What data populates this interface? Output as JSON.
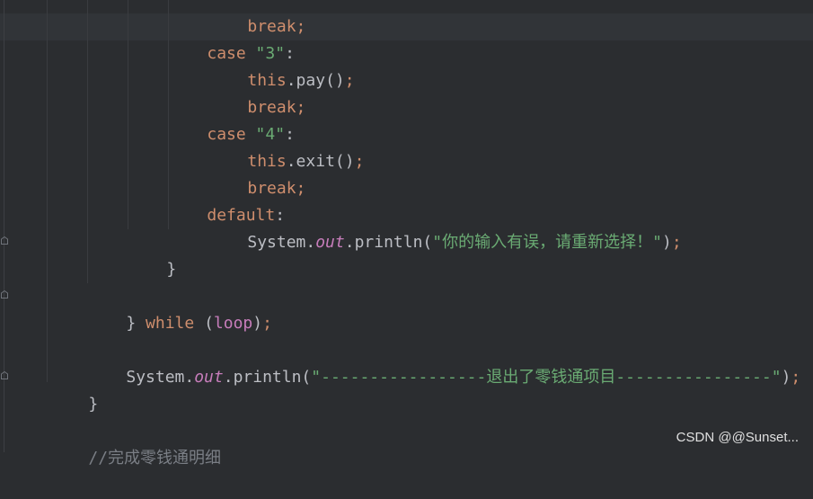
{
  "code": {
    "l0": {
      "kw": "break;"
    },
    "l1": {
      "kw": "case ",
      "str": "\"3\"",
      "tail": ":"
    },
    "l2": {
      "this": "this",
      "call": ".pay()",
      "semi": ";"
    },
    "l3": {
      "kw": "break;"
    },
    "l4": {
      "kw": "case ",
      "str": "\"4\"",
      "tail": ":"
    },
    "l5": {
      "this": "this",
      "call": ".exit()",
      "semi": ";"
    },
    "l6": {
      "kw": "break;"
    },
    "l7": {
      "kw": "default",
      "tail": ":"
    },
    "l8": {
      "pre": "System.",
      "field": "out",
      "mid": ".println(",
      "str": "\"你的输入有误，请重新选择！\"",
      "post": ")",
      "semi": ";"
    },
    "l9": {
      "brace": "}"
    },
    "l11": {
      "brace": "} ",
      "kw": "while",
      "open": " (",
      "field": "loop",
      "close": ")",
      "semi": ";"
    },
    "l13": {
      "pre": "System.",
      "field": "out",
      "mid": ".println(",
      "str": "\"-----------------退出了零钱通项目----------------\"",
      "post": ")",
      "semi": ";"
    },
    "l14": {
      "brace": "}"
    },
    "l16": {
      "comment": "//完成零钱通明细"
    }
  },
  "watermark": "CSDN @@Sunset..."
}
